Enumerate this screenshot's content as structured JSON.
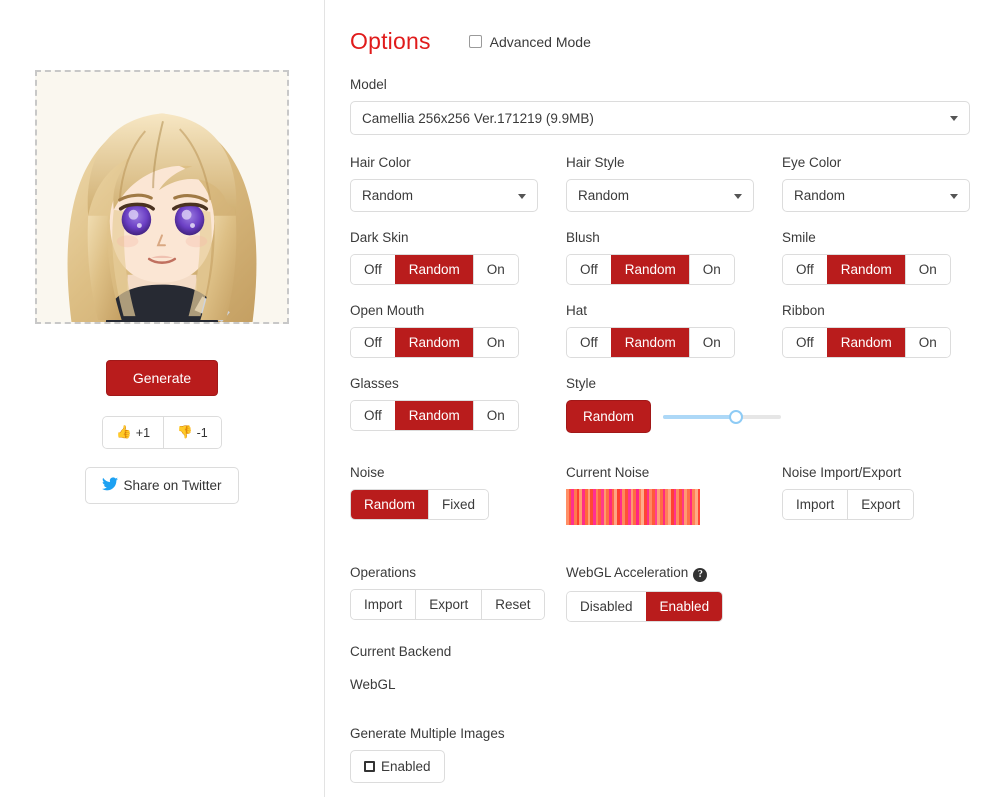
{
  "left": {
    "preview_alt": "generated anime character portrait",
    "generate_label": "Generate",
    "upvote_label": "+1",
    "downvote_label": "-1",
    "share_label": "Share on Twitter"
  },
  "options": {
    "title": "Options",
    "advanced_mode_label": "Advanced Mode",
    "advanced_mode_checked": false
  },
  "model": {
    "label": "Model",
    "value": "Camellia 256x256 Ver.171219 (9.9MB)"
  },
  "selects": [
    {
      "label": "Hair Color",
      "value": "Random"
    },
    {
      "label": "Hair Style",
      "value": "Random"
    },
    {
      "label": "Eye Color",
      "value": "Random"
    }
  ],
  "toggles": [
    {
      "label": "Dark Skin",
      "options": [
        "Off",
        "Random",
        "On"
      ],
      "selected": "Random"
    },
    {
      "label": "Blush",
      "options": [
        "Off",
        "Random",
        "On"
      ],
      "selected": "Random"
    },
    {
      "label": "Smile",
      "options": [
        "Off",
        "Random",
        "On"
      ],
      "selected": "Random"
    },
    {
      "label": "Open Mouth",
      "options": [
        "Off",
        "Random",
        "On"
      ],
      "selected": "Random"
    },
    {
      "label": "Hat",
      "options": [
        "Off",
        "Random",
        "On"
      ],
      "selected": "Random"
    },
    {
      "label": "Ribbon",
      "options": [
        "Off",
        "Random",
        "On"
      ],
      "selected": "Random"
    },
    {
      "label": "Glasses",
      "options": [
        "Off",
        "Random",
        "On"
      ],
      "selected": "Random"
    }
  ],
  "style": {
    "label": "Style",
    "random_label": "Random",
    "slider_percent": 62
  },
  "noise": {
    "label": "Noise",
    "options": [
      "Random",
      "Fixed"
    ],
    "selected": "Random"
  },
  "current_noise": {
    "label": "Current Noise",
    "bars": [
      "#ff8f66",
      "#ff5a3c",
      "#ff2f8f",
      "#ff7a4d",
      "#ff3d2e",
      "#ff9c70",
      "#ff2e86",
      "#ff6a3a",
      "#ffa177",
      "#ff4a33",
      "#ff2f94",
      "#ff8255",
      "#ff5c3e",
      "#ff3b8a",
      "#ff9b6c",
      "#ff7043",
      "#ff2a7f",
      "#ff6347",
      "#ffa583",
      "#ff3f30",
      "#ff2d8e",
      "#ff8a5c",
      "#ff5138",
      "#ff3592",
      "#ff9775",
      "#ff6b41",
      "#ff2486",
      "#ff7d52",
      "#ffad8b",
      "#ff4536",
      "#ff2f8a",
      "#ff8763",
      "#ff5a3a",
      "#ff3e95",
      "#ff9e79",
      "#ff6d44",
      "#ff2b80",
      "#ff7f58",
      "#ffa77f",
      "#ff4231",
      "#ff3190",
      "#ff8b5f",
      "#ff5437",
      "#ff3888",
      "#ff9a71",
      "#ff6f49",
      "#ff2783",
      "#ff8255",
      "#ffab86",
      "#ff4734"
    ]
  },
  "noise_io": {
    "label": "Noise Import/Export",
    "import_label": "Import",
    "export_label": "Export"
  },
  "operations": {
    "label": "Operations",
    "import_label": "Import",
    "export_label": "Export",
    "reset_label": "Reset"
  },
  "webgl": {
    "label": "WebGL Acceleration",
    "help_glyph": "?",
    "options": [
      "Disabled",
      "Enabled"
    ],
    "selected": "Enabled"
  },
  "backend": {
    "label": "Current Backend",
    "value": "WebGL"
  },
  "multi": {
    "label": "Generate Multiple Images",
    "button_label": "Enabled"
  },
  "colors": {
    "accent_red": "#b91c1c",
    "title_red": "#e01b1b",
    "slider_blue": "#8ecbf5",
    "twitter_blue": "#1da1f2"
  }
}
